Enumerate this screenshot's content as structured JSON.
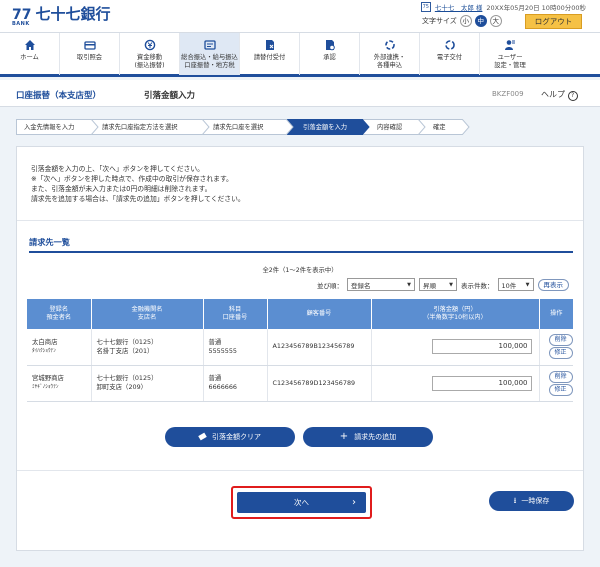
{
  "header": {
    "logo_mark": "77",
    "logo_sub": "BANK",
    "bank_name": "七十七銀行",
    "user_name": "七十七　太郎 様",
    "login_time": "20XX年05月20日 10時00分00秒",
    "font_size_label": "文字サイズ",
    "font_sizes": [
      "小",
      "中",
      "大"
    ],
    "logout_label": "ログアウト"
  },
  "nav": [
    {
      "label": "ホーム",
      "icon": "home-icon"
    },
    {
      "label": "取引照会",
      "icon": "inquiry-icon"
    },
    {
      "label": "資金移動\n(振込振替)",
      "icon": "transfer-icon"
    },
    {
      "label": "総合振込・給与振込\n口座振替・地方税",
      "icon": "bulk-transfer-icon"
    },
    {
      "label": "請替付受付",
      "icon": "receipt-icon"
    },
    {
      "label": "承認",
      "icon": "approval-icon"
    },
    {
      "label": "外部連携・\n各種申込",
      "icon": "link-icon"
    },
    {
      "label": "電子交付",
      "icon": "document-icon"
    },
    {
      "label": "ユーザー\n設定・管理",
      "icon": "user-settings-icon"
    }
  ],
  "title": {
    "category": "口座振替（本支店型）",
    "page": "引落金額入力",
    "screen_id": "BKZF009",
    "help": "ヘルプ"
  },
  "steps": [
    "入金先情報を入力",
    "請求先口座指定方法を選択",
    "請求先口座を選択",
    "引落金額を入力",
    "内容確認",
    "確定"
  ],
  "intro": [
    "引落金額を入力の上、「次へ」ボタンを押してください。",
    "※「次へ」ボタンを押した時点で、作成中の取引が保存されます。",
    "また、引落金額が未入力または0円の明細は削除されます。",
    "請求先を追加する場合は、「請求先の追加」ボタンを押してください。"
  ],
  "section_title": "請求先一覧",
  "count_text": "全2件（1〜2件を表示中）",
  "controls": {
    "sort_label": "並び順：",
    "sort_value": "登録名",
    "order_value": "昇順",
    "per_page_label": "表示件数：",
    "per_page_value": "10件",
    "redisplay": "再表示"
  },
  "table": {
    "headers": [
      "登録名\n預金者名",
      "金融機関名\n支店名",
      "科目\n口座番号",
      "顧客番号",
      "引落金額（円）\n（半角数字10桁以内）",
      "操作"
    ],
    "rows": [
      {
        "name": "太白商店",
        "kana": "ﾀｲﾊｸｼｮｳﾃﾝ",
        "bank": "七十七銀行（0125）",
        "branch": "名掛丁支店（201）",
        "type": "普通",
        "account": "5555555",
        "customer": "A123456789B123456789",
        "amount": "100,000"
      },
      {
        "name": "宮城野商店",
        "kana": "ﾐﾔｷﾞﾉｼｮｳﾃﾝ",
        "bank": "七十七銀行（0125）",
        "branch": "卸町支店（209）",
        "type": "普通",
        "account": "6666666",
        "customer": "C123456789D123456789",
        "amount": "100,000"
      }
    ],
    "delete_label": "削除",
    "edit_label": "修正"
  },
  "buttons": {
    "clear": "引落金額クリア",
    "add": "請求先の追加",
    "next": "次へ",
    "save": "一時保存"
  }
}
